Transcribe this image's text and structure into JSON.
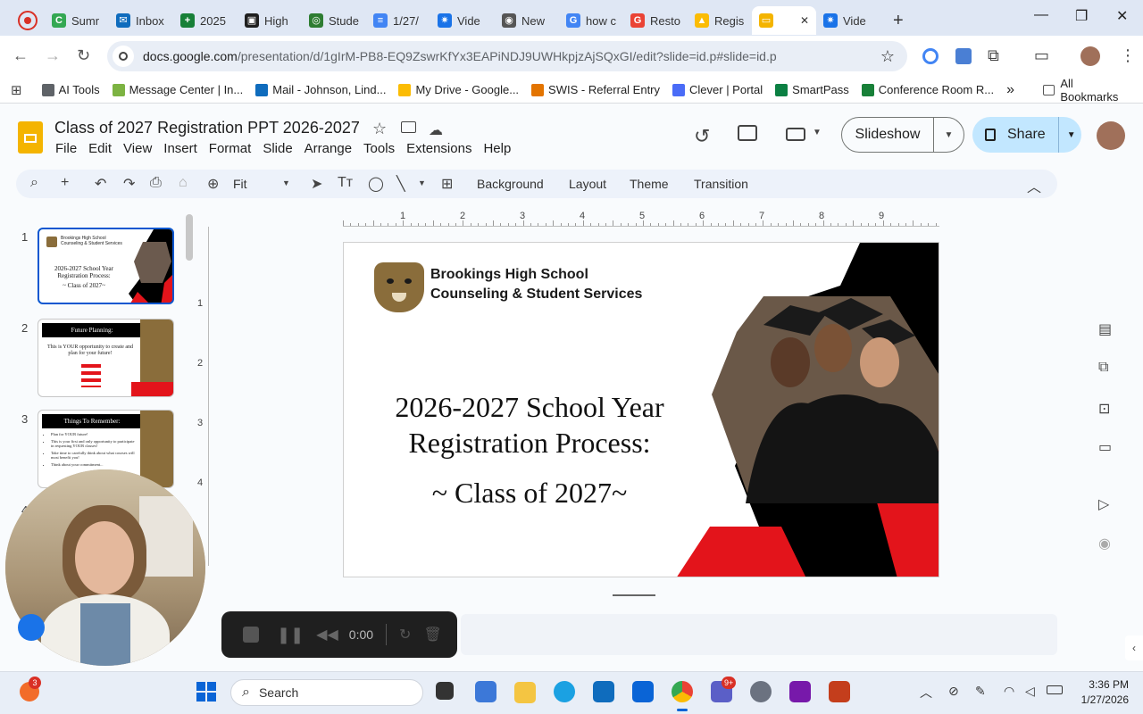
{
  "browser": {
    "tabs": [
      {
        "label": "Sumr",
        "color": "#34a853",
        "glyph": "C"
      },
      {
        "label": "Inbox",
        "color": "#0f6cbd",
        "glyph": "✉"
      },
      {
        "label": "2025",
        "color": "#188038",
        "glyph": "+"
      },
      {
        "label": "High",
        "color": "#1f1f1f",
        "glyph": "▣"
      },
      {
        "label": "Stude",
        "color": "#2e7d32",
        "glyph": "◎"
      },
      {
        "label": "1/27/",
        "color": "#4285f4",
        "glyph": "≡"
      },
      {
        "label": "Vide",
        "color": "#1a73e8",
        "glyph": "✷"
      },
      {
        "label": "New",
        "color": "#555555",
        "glyph": "◉"
      },
      {
        "label": "how c",
        "color": "#4285f4",
        "glyph": "G"
      },
      {
        "label": "Resto",
        "color": "#ea4335",
        "glyph": "G"
      },
      {
        "label": "Regis",
        "color": "#fbbc04",
        "glyph": "▲"
      },
      {
        "label": "",
        "color": "#f4b400",
        "glyph": "▭",
        "active": true
      },
      {
        "label": "Vide",
        "color": "#1a73e8",
        "glyph": "✷"
      }
    ],
    "new_tab": "+",
    "url_host": "docs.google.com",
    "url_path": "/presentation/d/1gIrM-PB8-EQ9ZswrKfYx3EAPiNDJ9UWHkpjzAjSQxGI/edit?slide=id.p#slide=id.p",
    "bookmarks": [
      {
        "label": "AI Tools",
        "color": "#5f6368"
      },
      {
        "label": "Message Center | In...",
        "color": "#7cb342"
      },
      {
        "label": "Mail - Johnson, Lind...",
        "color": "#0f6cbd"
      },
      {
        "label": "My Drive - Google...",
        "color": "#fbbc04"
      },
      {
        "label": "SWIS - Referral Entry",
        "color": "#e37400"
      },
      {
        "label": "Clever | Portal",
        "color": "#4a6cf7"
      },
      {
        "label": "SmartPass",
        "color": "#0b8043"
      },
      {
        "label": "Conference Room R...",
        "color": "#188038"
      }
    ],
    "more_bookmarks": "»",
    "all_bookmarks": "All Bookmarks"
  },
  "app": {
    "title": "Class of 2027 Registration PPT 2026-2027",
    "menu": [
      "File",
      "Edit",
      "View",
      "Insert",
      "Format",
      "Slide",
      "Arrange",
      "Tools",
      "Extensions",
      "Help"
    ],
    "slideshow_label": "Slideshow",
    "share_label": "Share",
    "toolbar": {
      "zoom": "Fit",
      "background": "Background",
      "layout": "Layout",
      "theme": "Theme",
      "transition": "Transition"
    },
    "ruler_ticks": [
      "1",
      "2",
      "3",
      "4",
      "5",
      "6",
      "7",
      "8",
      "9"
    ],
    "vruler_ticks": [
      "1",
      "2",
      "3",
      "4"
    ]
  },
  "slides": [
    {
      "num": "1",
      "school": "Brookings High School",
      "dept": "Counseling & Student Services",
      "line1": "2026-2027 School Year",
      "line2": "Registration Process:",
      "line3": "~ Class of 2027~"
    },
    {
      "num": "2",
      "heading": "Future Planning:",
      "body": "This is YOUR opportunity to create and plan for your future!"
    },
    {
      "num": "3",
      "heading": "Things To Remember:",
      "bullets": [
        "Plan for YOUR future!",
        "This is your first and only opportunity to participate in requesting YOUR classes!",
        "Take time to carefully think about what courses will most benefit you!",
        "Think about your commitment..."
      ]
    },
    {
      "num": "4"
    }
  ],
  "main_slide": {
    "school": "Brookings High School",
    "dept": "Counseling & Student Services",
    "line1": "2026-2027 School Year",
    "line2": "Registration Process:",
    "line3": "~ Class of 2027~"
  },
  "recorder": {
    "time": "0:00"
  },
  "taskbar": {
    "search": "Search",
    "time": "3:36 PM",
    "date": "1/27/2026",
    "badge": "3",
    "teams_badge": "9+"
  },
  "colors": {
    "red": "#e3141b",
    "black": "#000000",
    "accent": "#0b57d0",
    "share_bg": "#c2e7ff"
  }
}
